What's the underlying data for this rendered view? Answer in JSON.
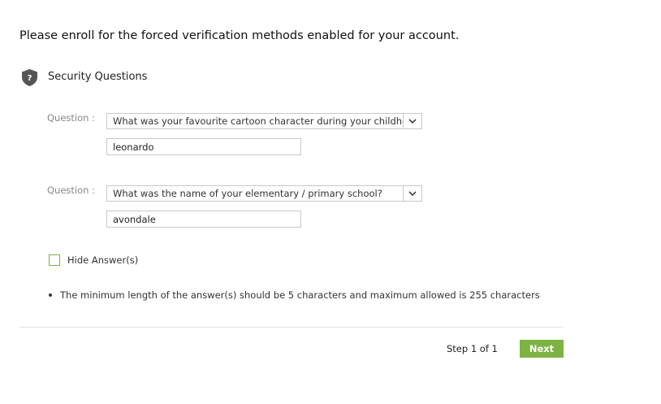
{
  "heading": "Please enroll for the forced verification methods enabled for your account.",
  "section": {
    "title": "Security Questions",
    "icon": "shield-question-icon",
    "icon_glyph": "?"
  },
  "questions": [
    {
      "label": "Question :",
      "selected": "What was your favourite cartoon character during your childhood?",
      "answer": "leonardo"
    },
    {
      "label": "Question :",
      "selected": "What was the name of your elementary / primary school?",
      "answer": "avondale"
    }
  ],
  "hide_answers": {
    "label": "Hide Answer(s)",
    "checked": false
  },
  "note": "The minimum length of the answer(s) should be 5 characters and maximum allowed is 255 characters",
  "footer": {
    "step": "Step 1 of 1",
    "next_label": "Next"
  },
  "colors": {
    "accent": "#7cb342",
    "icon": "#555555"
  }
}
